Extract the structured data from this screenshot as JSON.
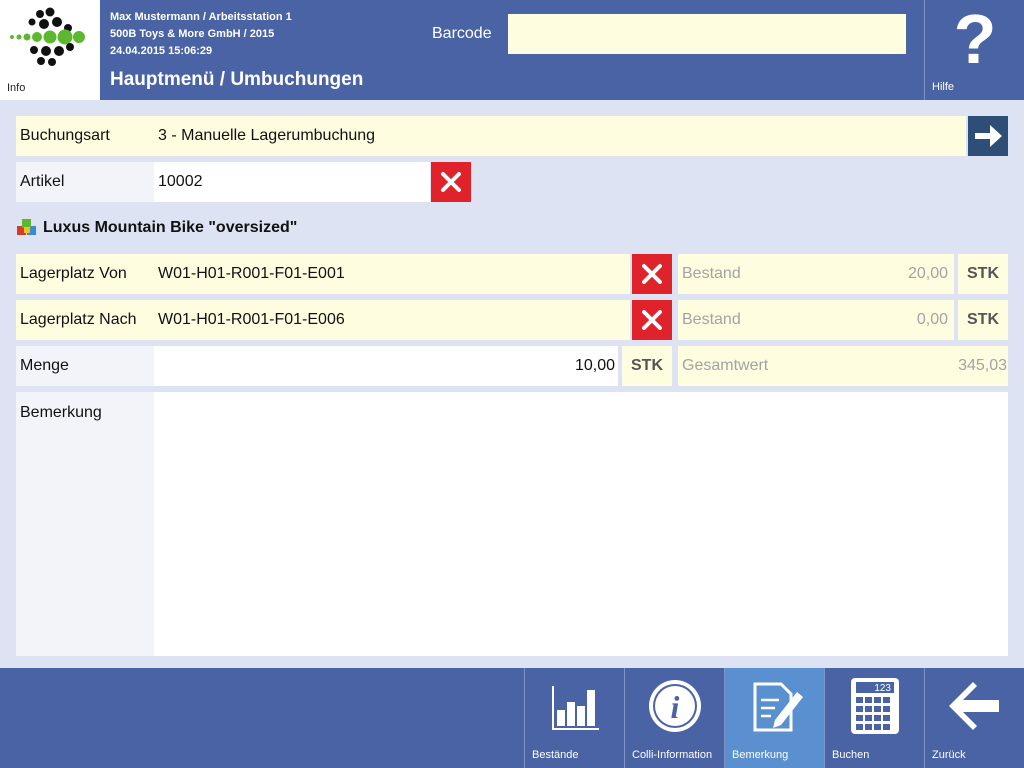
{
  "header": {
    "info_label": "Info",
    "session_line1": "Max Mustermann / Arbeitsstation 1",
    "session_line2": "500B Toys & More GmbH / 2015",
    "session_line3": "24.04.2015 15:06:29",
    "page_title": "Hauptmenü / Umbuchungen",
    "barcode_label": "Barcode",
    "barcode_value": "",
    "help_symbol": "?",
    "help_label": "Hilfe"
  },
  "form": {
    "buchungsart": {
      "label": "Buchungsart",
      "value": "3 - Manuelle Lagerumbuchung"
    },
    "artikel": {
      "label": "Artikel",
      "value": "10002"
    },
    "product_name": "Luxus Mountain Bike \"oversized\"",
    "lagerplatz_von": {
      "label": "Lagerplatz Von",
      "value": "W01-H01-R001-F01-E001",
      "bestand_label": "Bestand",
      "bestand_value": "20,00",
      "unit": "STK"
    },
    "lagerplatz_nach": {
      "label": "Lagerplatz Nach",
      "value": "W01-H01-R001-F01-E006",
      "bestand_label": "Bestand",
      "bestand_value": "0,00",
      "unit": "STK"
    },
    "menge": {
      "label": "Menge",
      "value": "10,00",
      "unit": "STK",
      "gesamtwert_label": "Gesamtwert",
      "gesamtwert_value": "345,03"
    },
    "bemerkung": {
      "label": "Bemerkung",
      "value": ""
    }
  },
  "footer": {
    "buttons": [
      {
        "label": "Bestände",
        "icon": "bar-chart-icon"
      },
      {
        "label": "Colli-Information",
        "icon": "info-circle-icon"
      },
      {
        "label": "Bemerkung",
        "icon": "note-pencil-icon",
        "active": true
      },
      {
        "label": "Buchen",
        "icon": "calculator-icon",
        "icon_text": "123"
      },
      {
        "label": "Zurück",
        "icon": "back-arrow-icon"
      }
    ]
  },
  "colors": {
    "header_bg": "#4a63a4",
    "page_bg": "#dde3f3",
    "field_bg": "#fffde0",
    "clear_button": "#e0222a",
    "next_button": "#2e4e78",
    "active_footer_button": "#5a8fd0"
  }
}
